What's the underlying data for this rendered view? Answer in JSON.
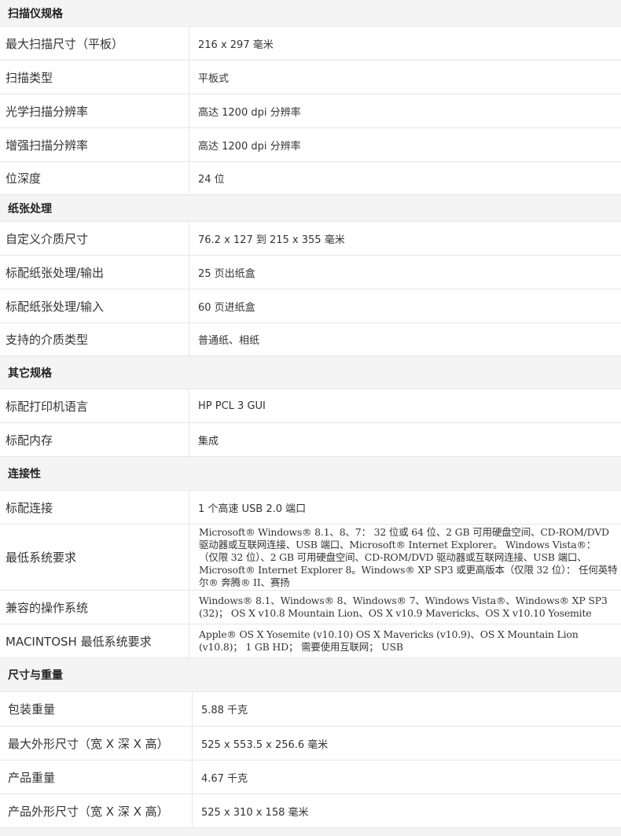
{
  "sections": [
    {
      "title": "扫描仪规格",
      "rows": [
        {
          "label": "最大扫描尺寸（平板）",
          "value": "216 x 297 毫米"
        },
        {
          "label": "扫描类型",
          "value": "平板式"
        },
        {
          "label": "光学扫描分辨率",
          "value": "高达 1200 dpi 分辨率"
        },
        {
          "label": "增强扫描分辨率",
          "value": "高达 1200 dpi 分辨率"
        },
        {
          "label": "位深度",
          "value": "24 位"
        }
      ]
    },
    {
      "title": "纸张处理",
      "rows": [
        {
          "label": "自定义介质尺寸",
          "value": "76.2 x 127 到 215 x 355 毫米"
        },
        {
          "label": "标配纸张处理/输出",
          "value": "25 页出纸盒"
        },
        {
          "label": "标配纸张处理/输入",
          "value": "60 页进纸盒"
        },
        {
          "label": "支持的介质类型",
          "value": "普通纸、相纸"
        }
      ]
    },
    {
      "title": "其它规格",
      "rows": [
        {
          "label": "标配打印机语言",
          "value": "HP PCL 3 GUI"
        },
        {
          "label": "标配内存",
          "value": "集成"
        }
      ]
    },
    {
      "title": "连接性",
      "rows": [
        {
          "label": "标配连接",
          "value": "1 个高速 USB 2.0 端口"
        },
        {
          "label": "最低系统要求",
          "value": "Microsoft® Windows® 8.1、8、7： 32 位或 64 位、2 GB 可用硬盘空间、CD-ROM/DVD 驱动器或互联网连接、USB 端口、Microsoft® Internet Explorer。 Windows Vista®： （仅限 32 位）、2 GB 可用硬盘空间、CD-ROM/DVD 驱动器或互联网连接、USB 端口、Microsoft® Internet Explorer 8。Windows® XP SP3 或更高版本（仅限 32 位）： 任何英特尔® 奔腾® II、赛扬"
        },
        {
          "label": "兼容的操作系统",
          "value": "Windows® 8.1、Windows® 8、Windows® 7、Windows Vista®、Windows® XP SP3 (32)； OS X v10.8 Mountain Lion、OS X v10.9 Mavericks、OS X v10.10 Yosemite"
        },
        {
          "label": "MACINTOSH 最低系统要求",
          "value": "Apple® OS X Yosemite (v10.10) OS X Mavericks (v10.9)、OS X Mountain Lion (v10.8)； 1 GB HD； 需要使用互联网； USB"
        }
      ]
    },
    {
      "title": "尺寸与重量",
      "rows": [
        {
          "label": "包装重量",
          "value": "5.88 千克"
        },
        {
          "label": "最大外形尺寸（宽 X 深 X 高）",
          "value": "525 x 553.5 x 256.6 毫米"
        },
        {
          "label": "产品重量",
          "value": "4.67 千克"
        },
        {
          "label": "产品外形尺寸（宽 X 深 X 高）",
          "value": "525 x 310 x 158 毫米"
        }
      ]
    }
  ]
}
